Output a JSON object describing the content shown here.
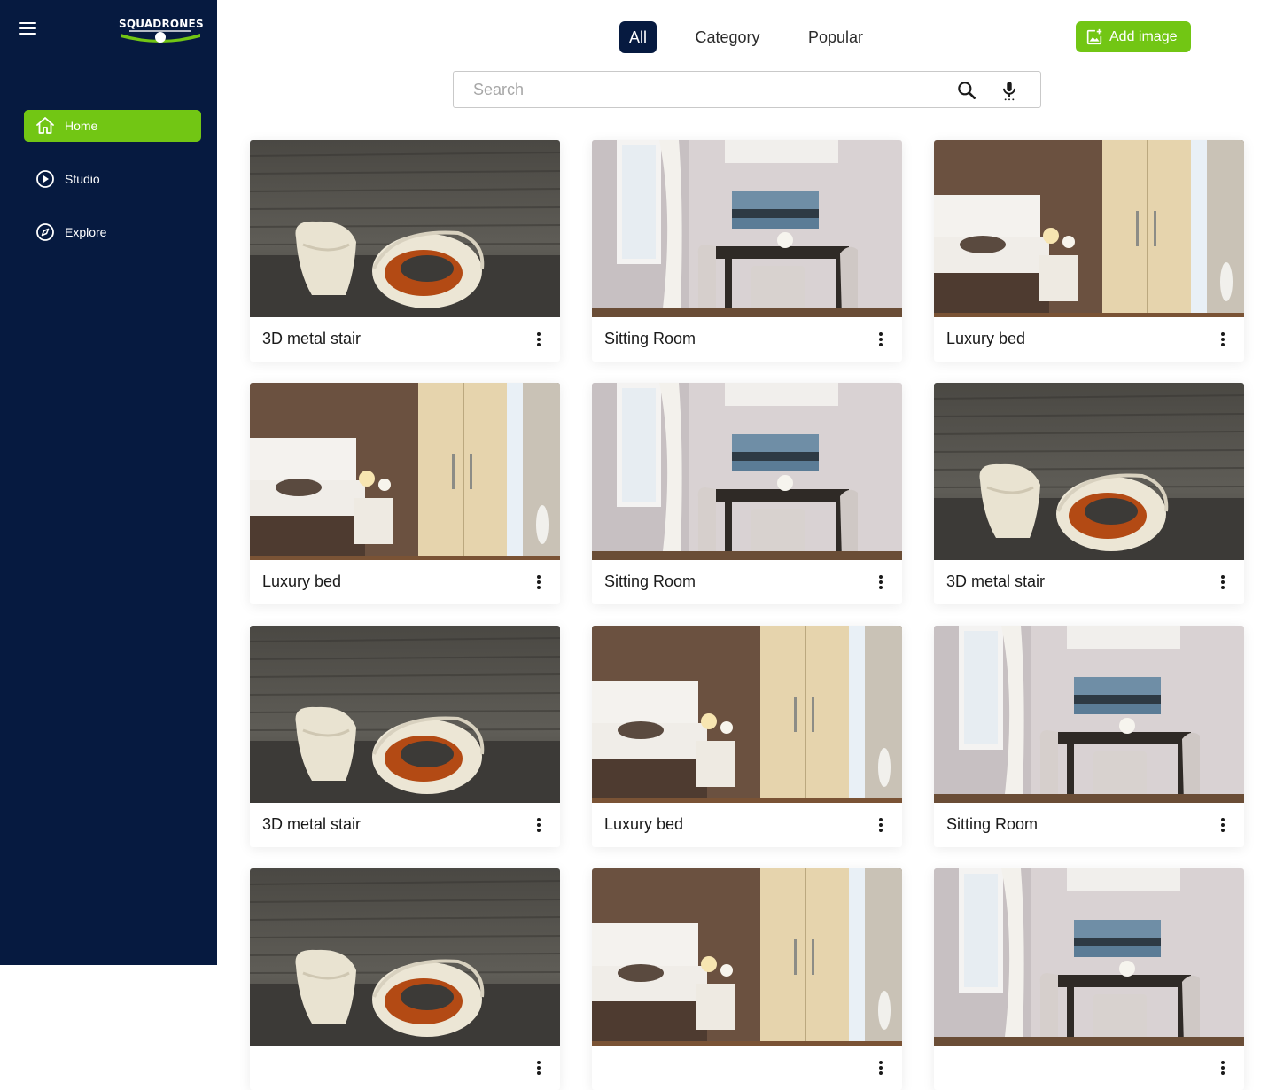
{
  "brand": {
    "name": "SQUADRONES"
  },
  "sidebar": {
    "items": [
      {
        "label": "Home",
        "icon": "home-icon",
        "active": true
      },
      {
        "label": "Studio",
        "icon": "play-circle-icon",
        "active": false
      },
      {
        "label": "Explore",
        "icon": "compass-icon",
        "active": false
      }
    ]
  },
  "tabs": [
    {
      "label": "All",
      "active": true
    },
    {
      "label": "Category",
      "active": false
    },
    {
      "label": "Popular",
      "active": false
    }
  ],
  "toolbar": {
    "add_label": "Add image",
    "add_icon": "add-photo-icon"
  },
  "search": {
    "placeholder": "Search",
    "search_icon": "search-icon",
    "mic_icon": "microphone-icon"
  },
  "gallery": {
    "cards": [
      {
        "title": "3D metal stair",
        "image": "chair"
      },
      {
        "title": "Sitting Room",
        "image": "dining"
      },
      {
        "title": "Luxury bed",
        "image": "bedroom"
      },
      {
        "title": "Luxury bed",
        "image": "bedroom"
      },
      {
        "title": "Sitting Room",
        "image": "dining"
      },
      {
        "title": "3D metal stair",
        "image": "chair"
      },
      {
        "title": "3D metal stair",
        "image": "chair"
      },
      {
        "title": "Luxury bed",
        "image": "bedroom"
      },
      {
        "title": "Sitting Room",
        "image": "dining"
      },
      {
        "title": "",
        "image": "chair"
      },
      {
        "title": "",
        "image": "bedroom"
      },
      {
        "title": "",
        "image": "dining"
      }
    ]
  },
  "colors": {
    "sidebar": "#061a40",
    "accent": "#72c614",
    "active_tab": "#061a40"
  }
}
